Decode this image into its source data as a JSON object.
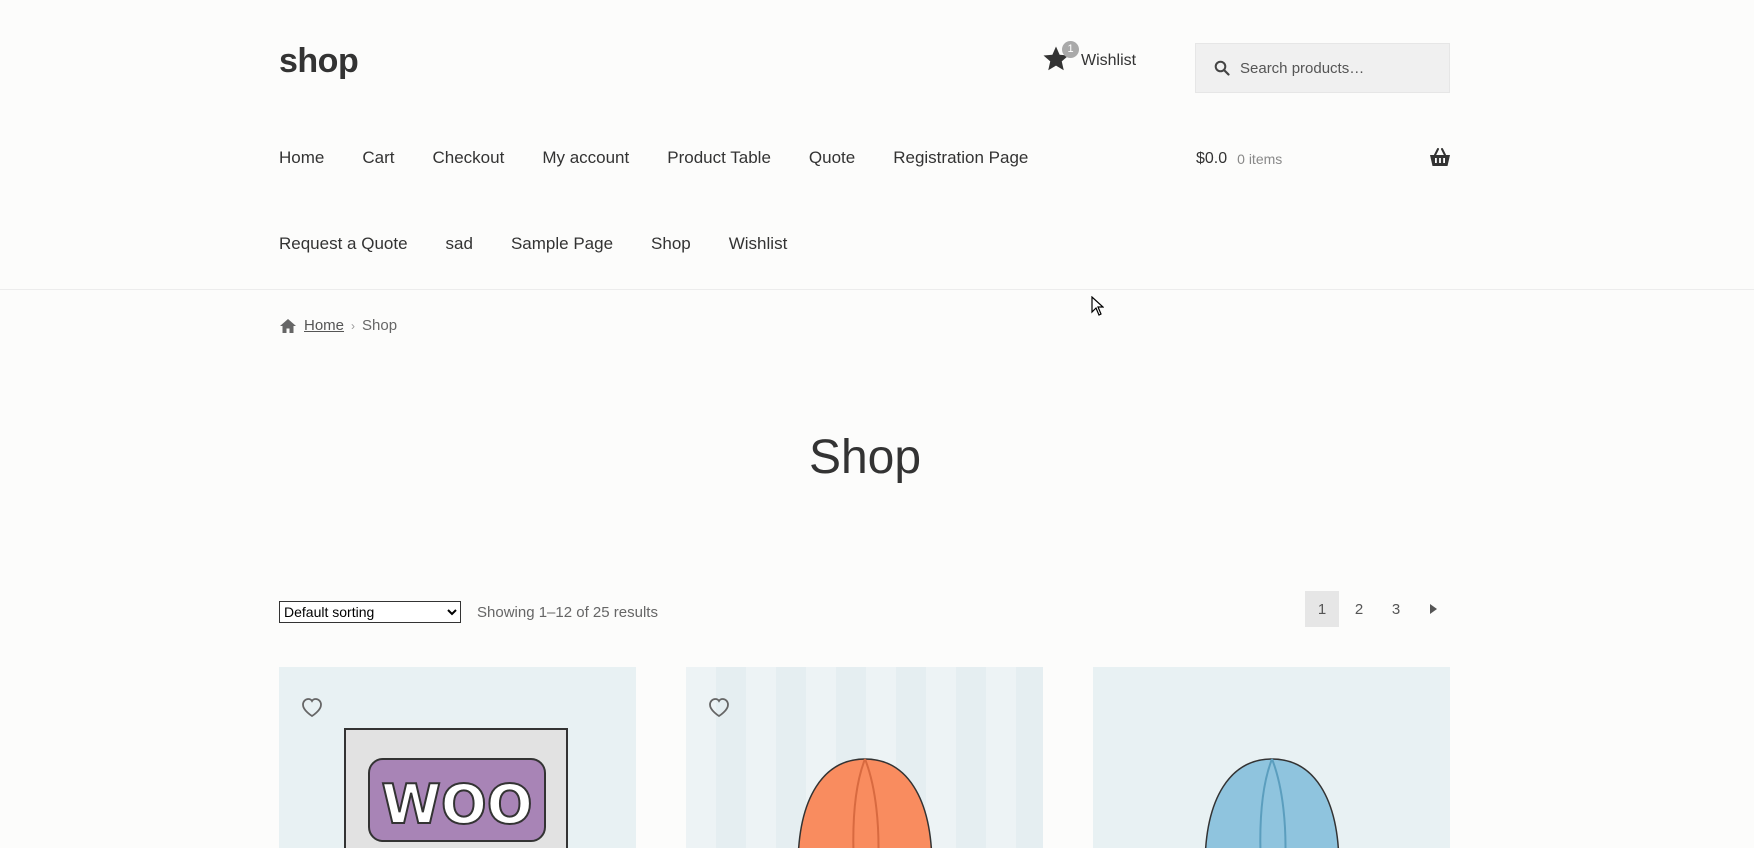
{
  "site": {
    "title": "shop"
  },
  "header": {
    "wishlist_label": "Wishlist",
    "wishlist_count": "1",
    "search_placeholder": "Search products…",
    "cart_amount": "$0.0",
    "cart_items": "0 items"
  },
  "nav": {
    "row1": [
      "Home",
      "Cart",
      "Checkout",
      "My account",
      "Product Table",
      "Quote",
      "Registration Page"
    ],
    "row2": [
      "Request a Quote",
      "sad",
      "Sample Page",
      "Shop",
      "Wishlist"
    ]
  },
  "breadcrumb": {
    "home": "Home",
    "current": "Shop"
  },
  "page": {
    "title": "Shop"
  },
  "toolbar": {
    "sorting_selected": "Default sorting",
    "result_count": "Showing 1–12 of 25 results",
    "pages": [
      "1",
      "2",
      "3"
    ],
    "current_page": "1"
  },
  "products": [
    {
      "image": "woo-poster",
      "color": "#e8f1f3"
    },
    {
      "image": "orange-beanie",
      "color": "#f98c5f"
    },
    {
      "image": "blue-beanie",
      "color": "#8fc4de"
    }
  ],
  "icons": {
    "wishlist": "star-icon",
    "search": "search-icon",
    "cart": "basket-icon",
    "breadcrumb": "home-icon",
    "favorite": "heart-icon",
    "next": "caret-right-icon"
  }
}
